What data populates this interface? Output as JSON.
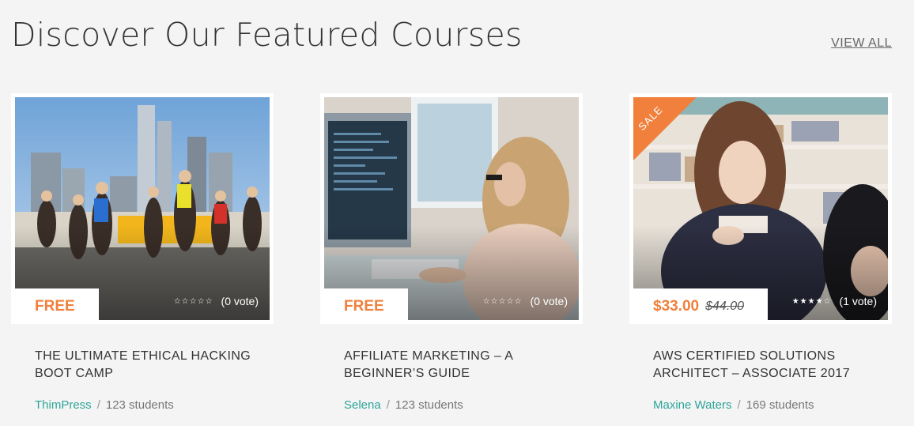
{
  "header": {
    "title": "Discover Our Featured Courses",
    "view_all": "VIEW ALL"
  },
  "courses": [
    {
      "price": "FREE",
      "old_price": "",
      "stars": "☆☆☆☆☆",
      "votes": "(0 vote)",
      "title": "THE ULTIMATE ETHICAL HACKING BOOT CAMP",
      "teacher": "ThimPress",
      "separator": "/",
      "students": "123 students",
      "sale": ""
    },
    {
      "price": "FREE",
      "old_price": "",
      "stars": "☆☆☆☆☆",
      "votes": "(0 vote)",
      "title": "AFFILIATE MARKETING – A BEGINNER’S GUIDE",
      "teacher": "Selena",
      "separator": "/",
      "students": "123 students",
      "sale": ""
    },
    {
      "price": "$33.00",
      "old_price": "$44.00",
      "stars": "★★★★☆",
      "votes": "(1 vote)",
      "title": "AWS CERTIFIED SOLUTIONS ARCHITECT – ASSOCIATE 2017",
      "teacher": "Maxine Waters",
      "separator": "/",
      "students": "169 students",
      "sale": "SALE"
    }
  ],
  "colors": {
    "accent": "#f0803c",
    "teacher_link": "#2ea59a"
  }
}
